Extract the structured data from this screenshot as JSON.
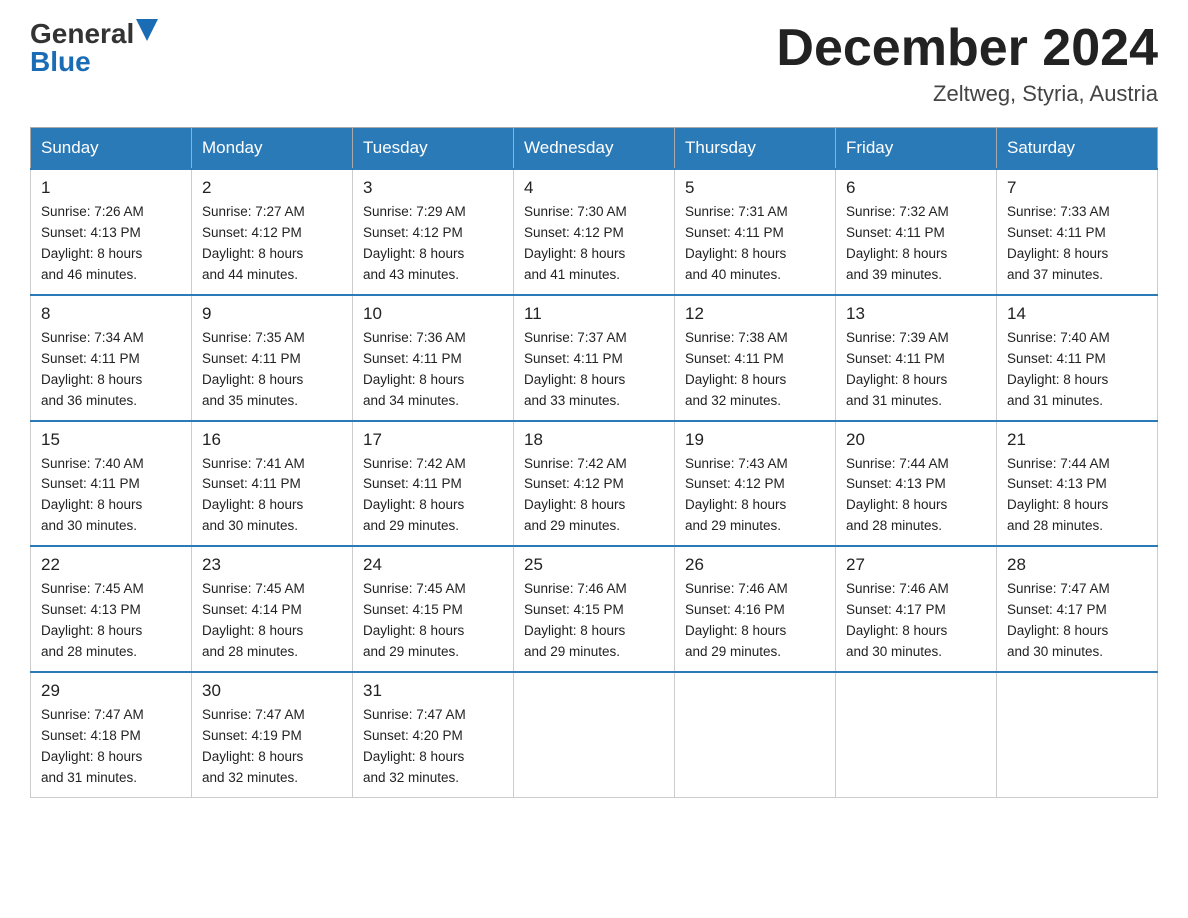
{
  "header": {
    "logo_general": "General",
    "logo_blue": "Blue",
    "month_title": "December 2024",
    "location": "Zeltweg, Styria, Austria"
  },
  "weekdays": [
    "Sunday",
    "Monday",
    "Tuesday",
    "Wednesday",
    "Thursday",
    "Friday",
    "Saturday"
  ],
  "weeks": [
    [
      {
        "day": "1",
        "sunrise": "7:26 AM",
        "sunset": "4:13 PM",
        "daylight": "8 hours and 46 minutes."
      },
      {
        "day": "2",
        "sunrise": "7:27 AM",
        "sunset": "4:12 PM",
        "daylight": "8 hours and 44 minutes."
      },
      {
        "day": "3",
        "sunrise": "7:29 AM",
        "sunset": "4:12 PM",
        "daylight": "8 hours and 43 minutes."
      },
      {
        "day": "4",
        "sunrise": "7:30 AM",
        "sunset": "4:12 PM",
        "daylight": "8 hours and 41 minutes."
      },
      {
        "day": "5",
        "sunrise": "7:31 AM",
        "sunset": "4:11 PM",
        "daylight": "8 hours and 40 minutes."
      },
      {
        "day": "6",
        "sunrise": "7:32 AM",
        "sunset": "4:11 PM",
        "daylight": "8 hours and 39 minutes."
      },
      {
        "day": "7",
        "sunrise": "7:33 AM",
        "sunset": "4:11 PM",
        "daylight": "8 hours and 37 minutes."
      }
    ],
    [
      {
        "day": "8",
        "sunrise": "7:34 AM",
        "sunset": "4:11 PM",
        "daylight": "8 hours and 36 minutes."
      },
      {
        "day": "9",
        "sunrise": "7:35 AM",
        "sunset": "4:11 PM",
        "daylight": "8 hours and 35 minutes."
      },
      {
        "day": "10",
        "sunrise": "7:36 AM",
        "sunset": "4:11 PM",
        "daylight": "8 hours and 34 minutes."
      },
      {
        "day": "11",
        "sunrise": "7:37 AM",
        "sunset": "4:11 PM",
        "daylight": "8 hours and 33 minutes."
      },
      {
        "day": "12",
        "sunrise": "7:38 AM",
        "sunset": "4:11 PM",
        "daylight": "8 hours and 32 minutes."
      },
      {
        "day": "13",
        "sunrise": "7:39 AM",
        "sunset": "4:11 PM",
        "daylight": "8 hours and 31 minutes."
      },
      {
        "day": "14",
        "sunrise": "7:40 AM",
        "sunset": "4:11 PM",
        "daylight": "8 hours and 31 minutes."
      }
    ],
    [
      {
        "day": "15",
        "sunrise": "7:40 AM",
        "sunset": "4:11 PM",
        "daylight": "8 hours and 30 minutes."
      },
      {
        "day": "16",
        "sunrise": "7:41 AM",
        "sunset": "4:11 PM",
        "daylight": "8 hours and 30 minutes."
      },
      {
        "day": "17",
        "sunrise": "7:42 AM",
        "sunset": "4:11 PM",
        "daylight": "8 hours and 29 minutes."
      },
      {
        "day": "18",
        "sunrise": "7:42 AM",
        "sunset": "4:12 PM",
        "daylight": "8 hours and 29 minutes."
      },
      {
        "day": "19",
        "sunrise": "7:43 AM",
        "sunset": "4:12 PM",
        "daylight": "8 hours and 29 minutes."
      },
      {
        "day": "20",
        "sunrise": "7:44 AM",
        "sunset": "4:13 PM",
        "daylight": "8 hours and 28 minutes."
      },
      {
        "day": "21",
        "sunrise": "7:44 AM",
        "sunset": "4:13 PM",
        "daylight": "8 hours and 28 minutes."
      }
    ],
    [
      {
        "day": "22",
        "sunrise": "7:45 AM",
        "sunset": "4:13 PM",
        "daylight": "8 hours and 28 minutes."
      },
      {
        "day": "23",
        "sunrise": "7:45 AM",
        "sunset": "4:14 PM",
        "daylight": "8 hours and 28 minutes."
      },
      {
        "day": "24",
        "sunrise": "7:45 AM",
        "sunset": "4:15 PM",
        "daylight": "8 hours and 29 minutes."
      },
      {
        "day": "25",
        "sunrise": "7:46 AM",
        "sunset": "4:15 PM",
        "daylight": "8 hours and 29 minutes."
      },
      {
        "day": "26",
        "sunrise": "7:46 AM",
        "sunset": "4:16 PM",
        "daylight": "8 hours and 29 minutes."
      },
      {
        "day": "27",
        "sunrise": "7:46 AM",
        "sunset": "4:17 PM",
        "daylight": "8 hours and 30 minutes."
      },
      {
        "day": "28",
        "sunrise": "7:47 AM",
        "sunset": "4:17 PM",
        "daylight": "8 hours and 30 minutes."
      }
    ],
    [
      {
        "day": "29",
        "sunrise": "7:47 AM",
        "sunset": "4:18 PM",
        "daylight": "8 hours and 31 minutes."
      },
      {
        "day": "30",
        "sunrise": "7:47 AM",
        "sunset": "4:19 PM",
        "daylight": "8 hours and 32 minutes."
      },
      {
        "day": "31",
        "sunrise": "7:47 AM",
        "sunset": "4:20 PM",
        "daylight": "8 hours and 32 minutes."
      },
      null,
      null,
      null,
      null
    ]
  ],
  "labels": {
    "sunrise": "Sunrise:",
    "sunset": "Sunset:",
    "daylight": "Daylight:"
  }
}
